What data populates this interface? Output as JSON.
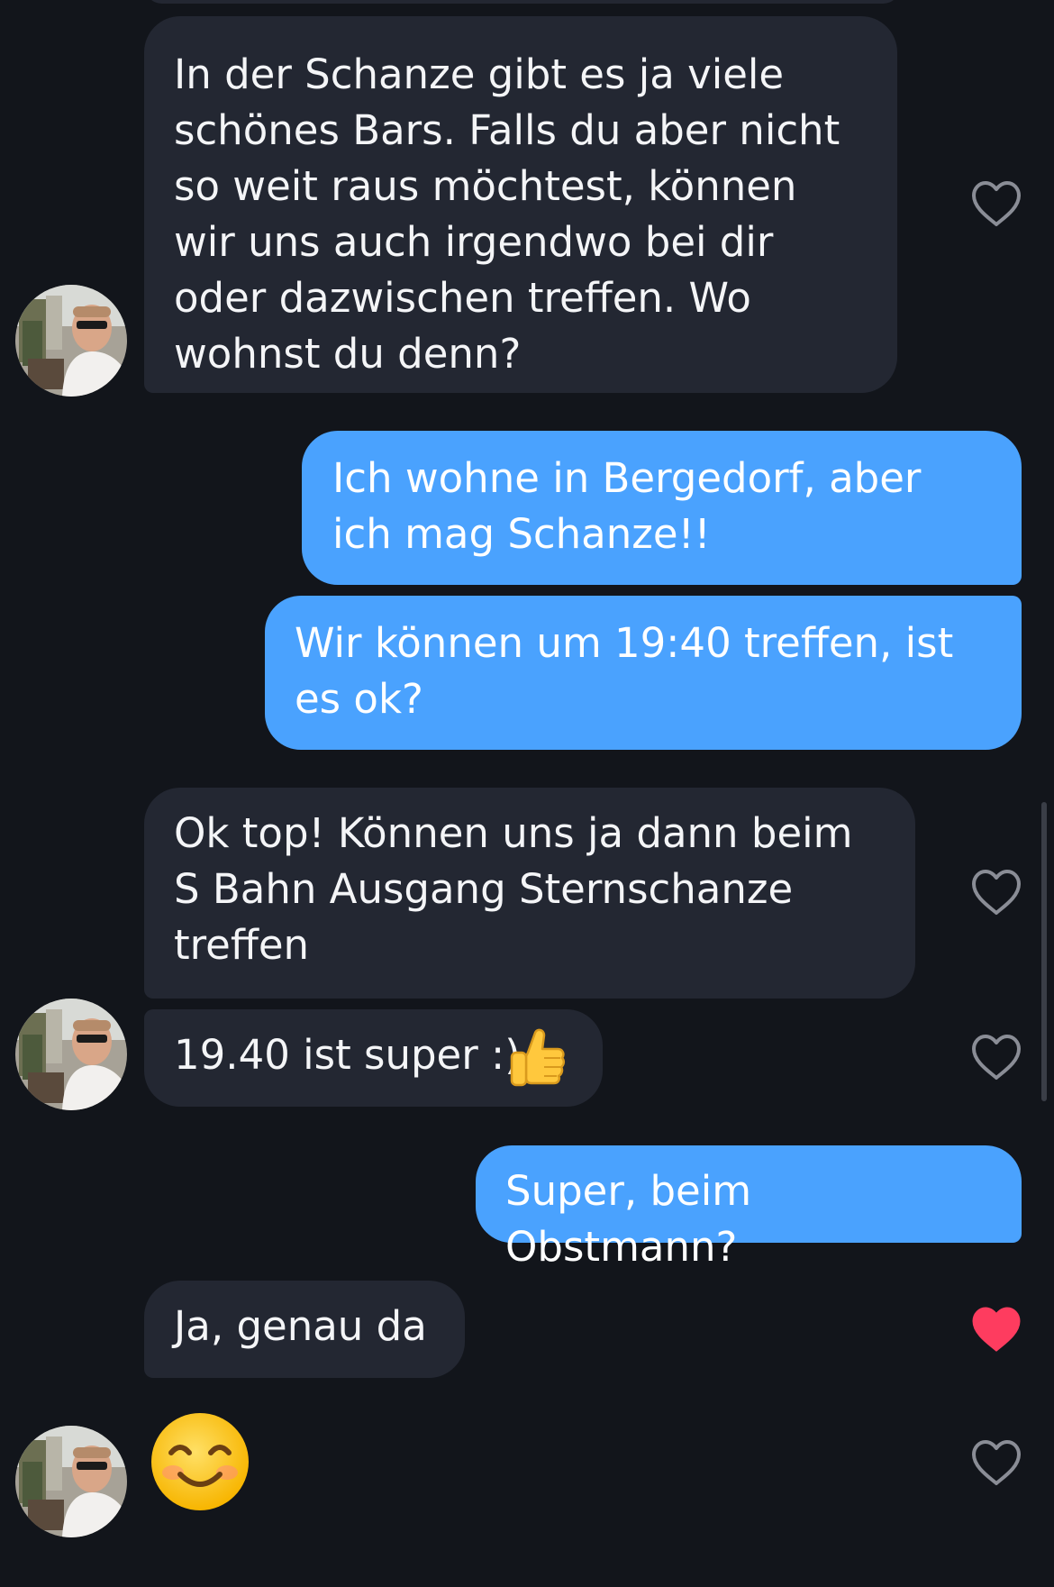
{
  "messages": [
    {
      "direction": "incoming",
      "text": "In der Schanze gibt es ja viele schönes Bars. Falls du aber nicht so weit raus möchtest, können wir uns auch irgendwo bei dir oder dazwischen treffen. Wo wohnst du denn?",
      "liked": false
    },
    {
      "direction": "outgoing",
      "text": "Ich wohne in Bergedorf, aber ich mag Schanze!!"
    },
    {
      "direction": "outgoing",
      "text": "Wir können um 19:40 treffen, ist es ok?"
    },
    {
      "direction": "incoming",
      "text": "Ok top! Können uns ja dann beim S Bahn Ausgang Sternschanze treffen",
      "liked": false
    },
    {
      "direction": "incoming",
      "text": "19.40 ist super :)",
      "emoji": "thumbs-up",
      "liked": false
    },
    {
      "direction": "outgoing",
      "text": "Super, beim Obstmann?"
    },
    {
      "direction": "incoming",
      "text": "Ja, genau da",
      "liked": true
    },
    {
      "direction": "incoming",
      "emoji": "smiling-face",
      "liked": false
    }
  ],
  "colors": {
    "background": "#12151b",
    "incoming_bubble": "#232732",
    "outgoing_bubble": "#4aa2fe",
    "heart_outline": "#8a8d96",
    "heart_liked": "#fe3c5f"
  },
  "icons": {
    "like": "heart-icon",
    "liked": "heart-filled-icon",
    "avatar": "contact-avatar"
  }
}
